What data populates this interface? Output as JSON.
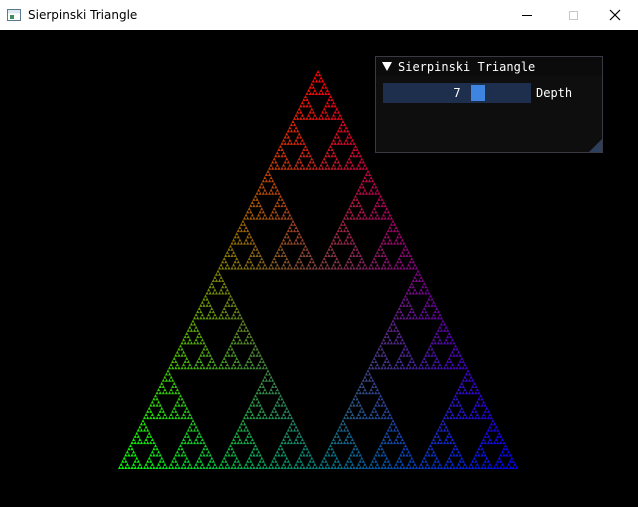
{
  "window": {
    "title": "Sierpinski Triangle",
    "controls": [
      "minimize",
      "maximize",
      "close"
    ]
  },
  "panel": {
    "header": "Sierpinski Triangle",
    "slider": {
      "value": 7,
      "label": "Depth"
    }
  },
  "fractal": {
    "depth": 7,
    "gradient_colors": {
      "top": "#ff0000",
      "bottom_left": "#00ff00",
      "bottom_right": "#0000ff"
    }
  },
  "icons": {
    "app": "app-window-icon",
    "minimize": "minimize-icon",
    "maximize": "maximize-icon",
    "close": "close-icon",
    "collapse": "triangle-down-icon"
  },
  "colors": {
    "background": "#000000",
    "slider_bg": "#1d2f4c",
    "slider_grab": "#3d85e0",
    "panel_bg": "#0f0f0f"
  }
}
